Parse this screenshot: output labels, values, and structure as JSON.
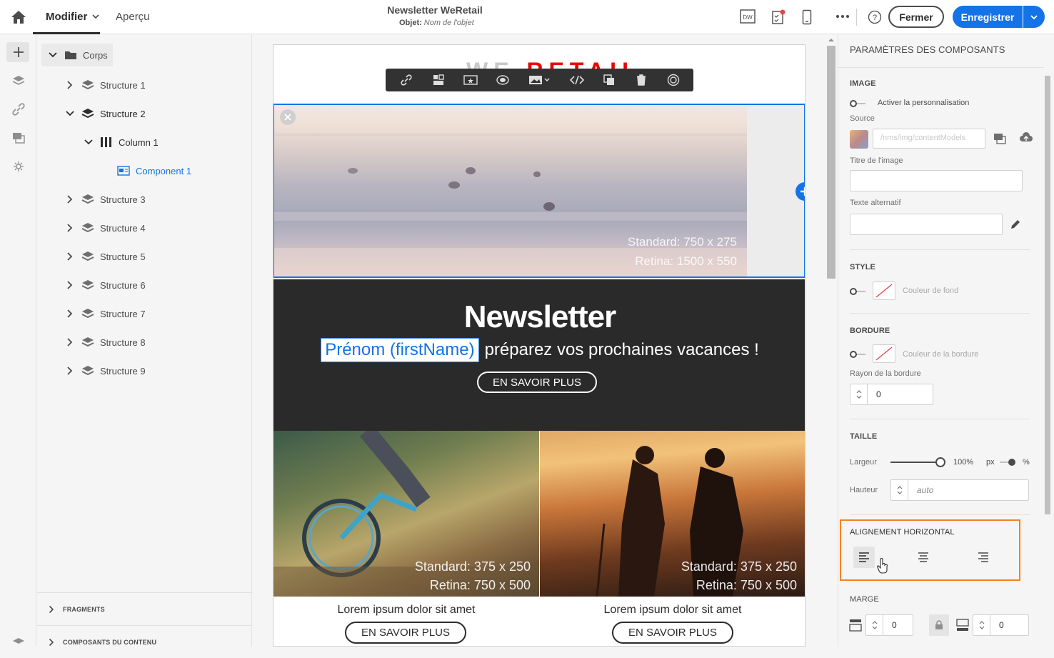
{
  "topbar": {
    "edit_label": "Modifier",
    "preview_label": "Aperçu",
    "doc_title": "Newsletter WeRetail",
    "subject_label": "Objet:",
    "subject_placeholder": "Nom de l'objet",
    "dw_label": "DW",
    "close_label": "Fermer",
    "save_label": "Enregistrer"
  },
  "tree": {
    "root": "Corps",
    "items": [
      {
        "label": "Structure 1"
      },
      {
        "label": "Structure 2"
      },
      {
        "label": "Column 1"
      },
      {
        "label": "Component 1"
      },
      {
        "label": "Structure 3"
      },
      {
        "label": "Structure 4"
      },
      {
        "label": "Structure 5"
      },
      {
        "label": "Structure 6"
      },
      {
        "label": "Structure 7"
      },
      {
        "label": "Structure 8"
      },
      {
        "label": "Structure 9"
      }
    ],
    "footer": [
      {
        "label": "FRAGMENTS"
      },
      {
        "label": "COMPOSANTS DU CONTENU"
      }
    ]
  },
  "email": {
    "logo_left": "WE",
    "logo_right": "RETAIL",
    "hero_dims": [
      "Standard: 750 x 275",
      "Retina: 1500 x 550"
    ],
    "newsletter_title": "Newsletter",
    "personalization_field": "Prénom (firstName)",
    "tagline": "préparez vos prochaines vacances !",
    "cta": "EN SAVOIR PLUS",
    "photo_dims": [
      "Standard: 375 x 250",
      "Retina: 750 x 500"
    ],
    "lorem": "Lorem ipsum dolor sit amet",
    "cta_small": "EN SAVOIR PLUS"
  },
  "panel": {
    "title": "PARAMÈTRES DES COMPOSANTS",
    "image": {
      "section": "IMAGE",
      "personalize_label": "Activer la personnalisation",
      "source_label": "Source",
      "source_value": "/nms/img/contentModels",
      "title_label": "Titre de l'image",
      "alt_label": "Texte alternatif"
    },
    "style": {
      "section": "STYLE",
      "bg_label": "Couleur de fond"
    },
    "border": {
      "section": "BORDURE",
      "color_label": "Couleur de la bordure",
      "radius_label": "Rayon de la bordure",
      "radius_value": "0"
    },
    "size": {
      "section": "TAILLE",
      "width_label": "Largeur",
      "width_value": "100%",
      "unit_px": "px",
      "unit_pct": "%",
      "width_fraction": 1.0,
      "height_label": "Hauteur",
      "height_placeholder": "auto"
    },
    "align": {
      "section": "ALIGNEMENT HORIZONTAL",
      "selected": "left"
    },
    "margin": {
      "section": "MARGE",
      "top_value": "0",
      "bottom_value": "0"
    }
  },
  "colors": {
    "accent": "#1473e6",
    "highlight": "#f5821f",
    "logo_red": "#e00000",
    "dark_band": "#2a2a2a"
  }
}
